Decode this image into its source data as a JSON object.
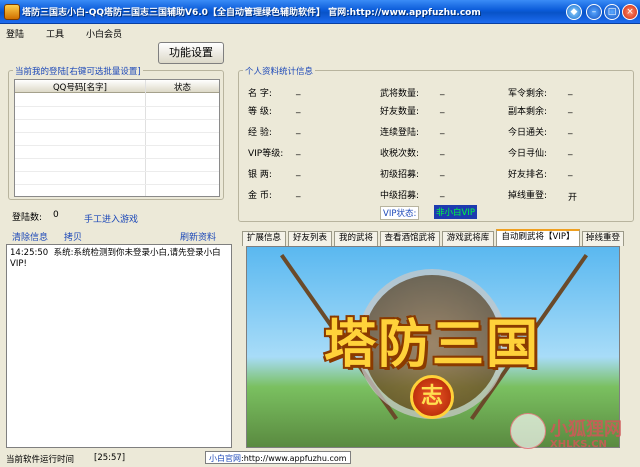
{
  "window": {
    "title": "塔防三国志小白-QQ塔防三国志三国辅助V6.0【全自动管理绿色辅助软件】 官网:http://www.appfuzhu.com"
  },
  "menu": [
    "登陆",
    "工具",
    "小白会员"
  ],
  "func_button": "功能设置",
  "login_group": {
    "title": "当前我的登陆[右键可选批量设置]",
    "columns": [
      "QQ号码[名字]",
      "状态"
    ]
  },
  "login_count": {
    "label": "登陆数:",
    "value": "0"
  },
  "manual_login": "手工进入游戏",
  "actions": {
    "clear": "清除信息",
    "copy": "拷贝",
    "refresh": "刷新资料"
  },
  "log": {
    "time": "14:25:50",
    "message": "系统:系统检测到你未登录小白,请先登录小白VIP!"
  },
  "status_bar": {
    "runtime_label": "当前软件运行时间",
    "runtime_value": "[25:57]",
    "site_label": "小白官网",
    "site_url": ":http://www.appfuzhu.com"
  },
  "stats": {
    "title": "个人资料统计信息",
    "col1": [
      {
        "label": "名   字:",
        "value": "_"
      },
      {
        "label": "等   级:",
        "value": "_"
      },
      {
        "label": "经   验:",
        "value": "_"
      },
      {
        "label": "VIP等级:",
        "value": "_"
      },
      {
        "label": "银   两:",
        "value": "_"
      },
      {
        "label": "金   币:",
        "value": "_"
      }
    ],
    "col2": [
      {
        "label": "武将数量:",
        "value": "_"
      },
      {
        "label": "好友数量:",
        "value": "_"
      },
      {
        "label": "连续登陆:",
        "value": "_"
      },
      {
        "label": "收税次数:",
        "value": "_"
      },
      {
        "label": "初级招募:",
        "value": "_"
      },
      {
        "label": "中级招募:",
        "value": "_"
      }
    ],
    "col3": [
      {
        "label": "军令剩余:",
        "value": "_"
      },
      {
        "label": "副本剩余:",
        "value": "_"
      },
      {
        "label": "今日通关:",
        "value": "_"
      },
      {
        "label": "今日寻仙:",
        "value": "_"
      },
      {
        "label": "好友排名:",
        "value": "_"
      },
      {
        "label": "掉线重登:",
        "value": "开"
      }
    ],
    "vip_label": "VIP状态:",
    "vip_value": "非小白VIP"
  },
  "tabs": [
    "扩展信息",
    "好友列表",
    "我的武将",
    "查看酒馆武将",
    "游戏武将库",
    "自动刷武将【VIP】",
    "掉线重登"
  ],
  "active_tab": 5,
  "banner": {
    "title": "塔防三国",
    "seal": "志"
  },
  "watermark": {
    "big": "小狐狸网",
    "small": "XHLKS.CN"
  },
  "colors": {
    "titlebar": "#0a5ad8",
    "link": "#1c48b8",
    "vip_bg": "#1d3bb0",
    "vip_text": "#00ff40"
  }
}
